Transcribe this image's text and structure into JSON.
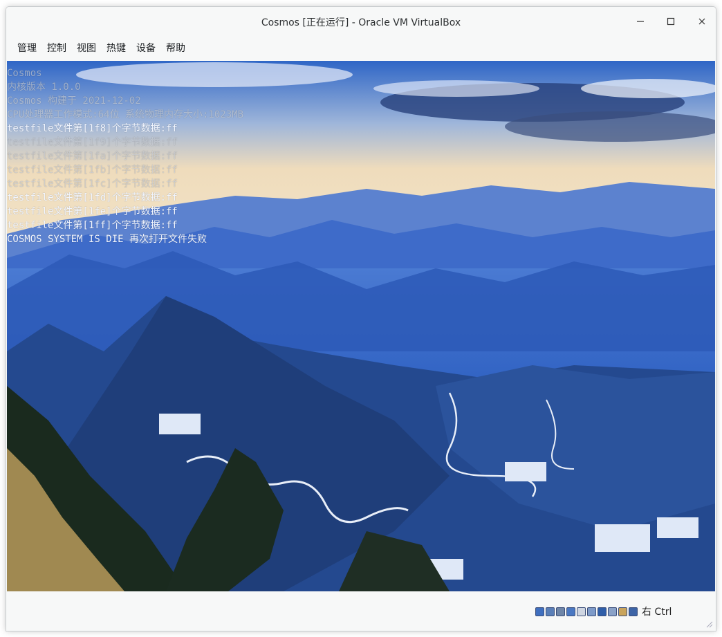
{
  "window": {
    "title": "Cosmos [正在运行] - Oracle VM VirtualBox"
  },
  "menu": [
    {
      "label": "管理"
    },
    {
      "label": "控制"
    },
    {
      "label": "视图"
    },
    {
      "label": "热键"
    },
    {
      "label": "设备"
    },
    {
      "label": "帮助"
    }
  ],
  "console": {
    "lines": [
      {
        "text": "Cosmos",
        "faint": true
      },
      {
        "text": "内核版本 1.0.0",
        "faint": true
      },
      {
        "text": "Cosmos 构建于 2021-12-02",
        "faint": true
      },
      {
        "text": "CPU处理器工作模式:64位 系统物理内存大小:1023MB",
        "faint": true
      },
      {
        "text": "testfile文件第[1f8]个字节数据:ff",
        "faint": false
      },
      {
        "text": "testfile文件第[1f9]个字节数据:ff",
        "faint": true
      },
      {
        "text": "testfile文件第[1fa]个字节数据:ff",
        "faint": true
      },
      {
        "text": "testfile文件第[1fb]个字节数据:ff",
        "faint": true
      },
      {
        "text": "testfile文件第[1fc]个字节数据:ff",
        "faint": true
      },
      {
        "text": "testfile文件第[1fd]个字节数据:ff",
        "faint": false
      },
      {
        "text": "testfile文件第[1fe]个字节数据:ff",
        "faint": false
      },
      {
        "text": "testfile文件第[1ff]个字节数据:ff",
        "faint": false
      },
      {
        "text": "COSMOS SYSTEM IS DIE 再次打开文件失败",
        "faint": false
      }
    ]
  },
  "statusbar": {
    "tray_icons": [
      {
        "name": "hard-disk-icon",
        "color": "#3f6fbf"
      },
      {
        "name": "optical-drive-icon",
        "color": "#5a7fb8"
      },
      {
        "name": "audio-icon",
        "color": "#6f86a8"
      },
      {
        "name": "network-icon",
        "color": "#4a78c2"
      },
      {
        "name": "usb-icon",
        "color": "#cfd6e2"
      },
      {
        "name": "shared-folders-icon",
        "color": "#7e9bc9"
      },
      {
        "name": "display-icon",
        "color": "#2f5ea8"
      },
      {
        "name": "recording-icon",
        "color": "#8aa2c8"
      },
      {
        "name": "mouse-integration-icon",
        "color": "#c9a45c"
      },
      {
        "name": "keyboard-capture-icon",
        "color": "#3d64a6"
      }
    ],
    "host_key": "右 Ctrl"
  },
  "colors": {
    "sky": "#e8dcc4",
    "cloud": "#f2f5ff",
    "mountain_far": "#3e6bc9",
    "mountain_mid": "#2d5bb8",
    "mountain_near": "#1f3e7a",
    "foliage": "#1a2a1e",
    "grass": "#b89a5a"
  }
}
